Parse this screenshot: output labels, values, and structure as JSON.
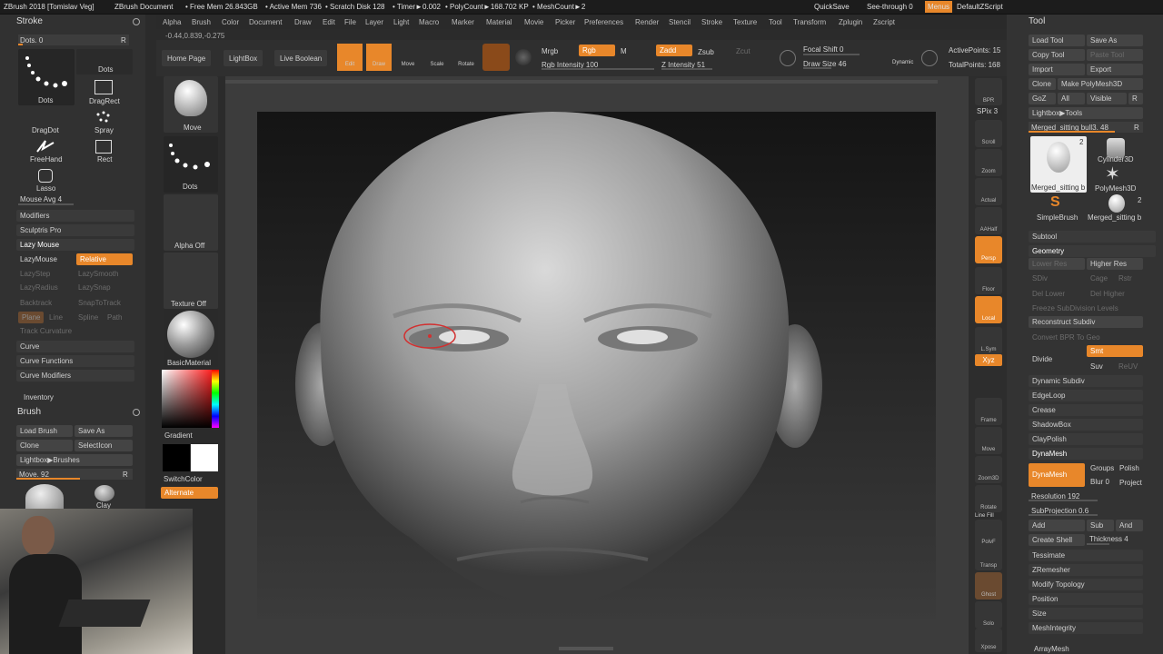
{
  "title_bar": {
    "app": "ZBrush 2018 [Tomislav Veg]",
    "doc": "ZBrush Document",
    "free_mem": "• Free Mem 26.843GB",
    "active_mem": "• Active Mem 736",
    "scratch": "• Scratch Disk 128",
    "timer": "• Timer►0.002",
    "polycount": "• PolyCount►168.702 KP",
    "meshcount": "• MeshCount►2",
    "quicksave": "QuickSave",
    "see_through": "See-through  0",
    "menus": "Menus",
    "script": "DefaultZScript"
  },
  "menu": [
    "Alpha",
    "Brush",
    "Color",
    "Document",
    "Draw",
    "Edit",
    "File",
    "Layer",
    "Light",
    "Macro",
    "Marker",
    "Material",
    "Movie",
    "Picker",
    "Preferences",
    "Render",
    "Stencil",
    "Stroke",
    "Texture",
    "Tool",
    "Transform",
    "Zplugin",
    "Zscript"
  ],
  "coords": "-0.44,0.839,-0.275",
  "toolbar": {
    "home": "Home Page",
    "lightbox": "LightBox",
    "live_boolean": "Live Boolean",
    "edit": "Edit",
    "draw": "Draw",
    "move": "Move",
    "scale": "Scale",
    "rotate": "Rotate",
    "mrgb": "Mrgb",
    "rgb": "Rgb",
    "m": "M",
    "rgb_intensity": "Rgb Intensity 100",
    "zadd": "Zadd",
    "zsub": "Zsub",
    "zcut": "Zcut",
    "z_intensity": "Z Intensity 51",
    "focal_shift": "Focal Shift 0",
    "draw_size": "Draw Size 46",
    "dynamic": "Dynamic",
    "active_points": "ActivePoints: 15",
    "total_points": "TotalPoints: 168"
  },
  "stroke": {
    "title": "Stroke",
    "dots_slider": "Dots. 0",
    "r": "R",
    "strokes": [
      "Dots",
      "Dots",
      "DragDot",
      "DragRect",
      "Spray",
      "FreeHand",
      "Rect",
      "Lasso"
    ],
    "mouse_avg": "Mouse Avg 4",
    "modifiers": "Modifiers",
    "sculptris": "Sculptris Pro",
    "lazymouse": "Lazy Mouse",
    "lazymouse_btn": "LazyMouse",
    "relative": "Relative",
    "lazystep": "LazyStep",
    "lazysmooth": "LazySmooth",
    "lazyradius": "LazyRadius",
    "lazysnap": "LazySnap",
    "backtrack": "Backtrack",
    "snaptotrack": "SnapToTrack",
    "plane": "Plane",
    "line": "Line",
    "spline": "Spline",
    "path": "Path",
    "track_curvature": "Track Curvature",
    "curve": "Curve",
    "curve_functions": "Curve Functions",
    "curve_modifiers": "Curve Modifiers",
    "inventory": "Inventory"
  },
  "brush": {
    "title": "Brush",
    "load": "Load Brush",
    "save": "Save As",
    "clone": "Clone",
    "select_icon": "SelectIcon",
    "lightbox": "Lightbox▶Brushes",
    "move_slider": "Move. 92",
    "clay": "Clay"
  },
  "col2": {
    "move": "Move",
    "dots": "Dots",
    "alpha_off": "Alpha Off",
    "texture_off": "Texture Off",
    "material": "BasicMaterial",
    "gradient": "Gradient",
    "switch_color": "SwitchColor",
    "alternate": "Alternate"
  },
  "shelf": [
    "BPR",
    "SPix 3",
    "Scroll",
    "Zoom",
    "Actual",
    "AAHalf",
    "Persp",
    "Floor",
    "Local",
    "L.Sym",
    "Xyz",
    "Frame",
    "Move",
    "Zoom3D",
    "Rotate",
    "Line Fill",
    "PolyF",
    "Transp",
    "Ghost",
    "Solo",
    "Xpose"
  ],
  "tool": {
    "title": "Tool",
    "load": "Load Tool",
    "save": "Save As",
    "copy": "Copy Tool",
    "paste": "Paste Tool",
    "import": "Import",
    "export": "Export",
    "clone": "Clone",
    "make_polymesh": "Make PolyMesh3D",
    "goz": "GoZ",
    "all": "All",
    "visible": "Visible",
    "r": "R",
    "lightbox": "Lightbox▶Tools",
    "merged_slider": "Merged_sitting bull3. 48",
    "thumbs": [
      "Merged_sitting b",
      "Cylinder3D",
      "PolyMesh3D",
      "SimpleBrush",
      "Merged_sitting b"
    ],
    "thumb_counts": [
      "2",
      "2"
    ],
    "subtool": "Subtool",
    "geometry": "Geometry",
    "lower_res": "Lower Res",
    "higher_res": "Higher Res",
    "sdiv": "SDiv",
    "cage": "Cage",
    "rstr": "Rstr",
    "del_lower": "Del Lower",
    "del_higher": "Del Higher",
    "freeze": "Freeze SubDivision Levels",
    "reconstruct": "Reconstruct Subdiv",
    "convert_bpr": "Convert BPR To Geo",
    "divide": "Divide",
    "smt": "Smt",
    "suv": "Suv",
    "reuv": "ReUV",
    "dynamic_subdiv": "Dynamic Subdiv",
    "edgeloop": "EdgeLoop",
    "crease": "Crease",
    "shadowbox": "ShadowBox",
    "claypolish": "ClayPolish",
    "dynamesh_head": "DynaMesh",
    "dynamesh_btn": "DynaMesh",
    "groups": "Groups",
    "polish": "Polish",
    "blur": "Blur 0",
    "project": "Project",
    "resolution": "Resolution 192",
    "subprojection": "SubProjection 0.6",
    "add": "Add",
    "sub": "Sub",
    "and": "And",
    "create_shell": "Create Shell",
    "thickness": "Thickness 4",
    "tessimate": "Tessimate",
    "zremesher": "ZRemesher",
    "modify_topology": "Modify Topology",
    "position": "Position",
    "size": "Size",
    "meshintegrity": "MeshIntegrity",
    "arraymesh": "ArrayMesh"
  }
}
